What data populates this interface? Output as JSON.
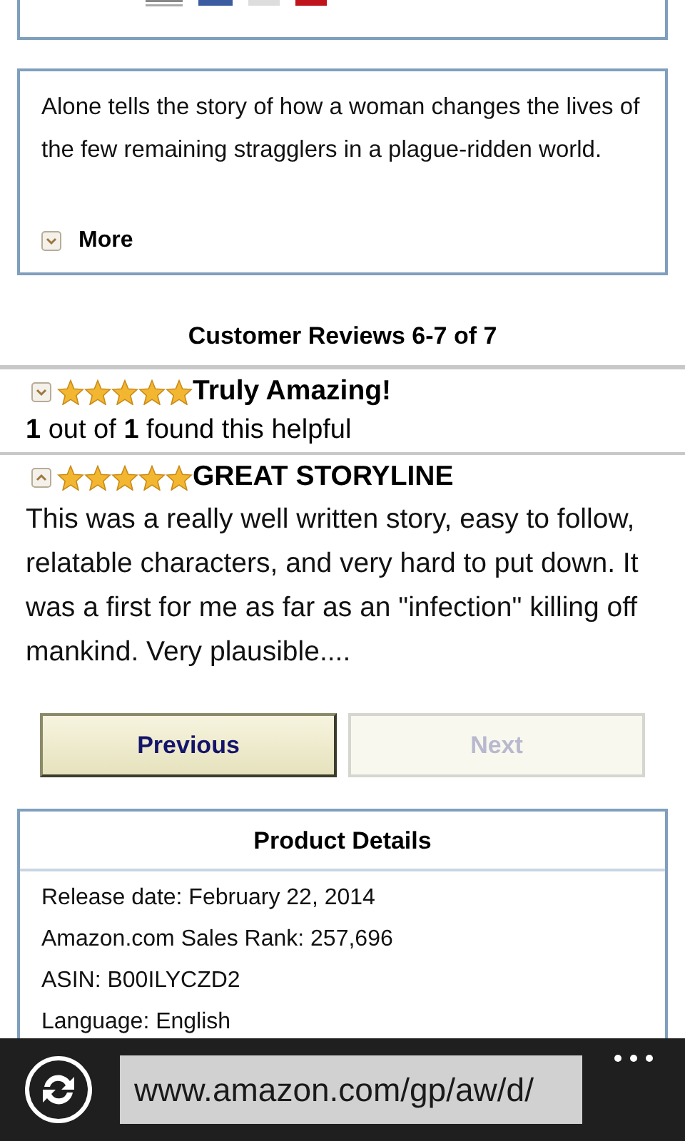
{
  "description": {
    "text": "Alone tells the story of how a woman changes the lives of the few remaining stragglers in a plague-ridden world.",
    "more": {
      "label": "More",
      "expanded": false
    }
  },
  "reviews_heading": "Customer Reviews 6-7 of 7",
  "reviews": [
    {
      "title": "Truly Amazing!",
      "stars": 5,
      "expanded": false,
      "helpful": "**1** out of **1** found this helpful"
    },
    {
      "title": "GREAT STORYLINE",
      "stars": 5,
      "expanded": true,
      "body": "This was a really well written story, easy to follow, relatable characters, and very hard to put down. It was a first for me as far as an \"infection\" killing off mankind. Very plausible...."
    }
  ],
  "pagination": [
    {
      "label": "Previous",
      "disabled": false
    },
    {
      "label": "Next",
      "disabled": true
    }
  ],
  "product_details": {
    "title": "Product Details",
    "rows": [
      "Release date: February 22, 2014",
      "Amazon.com Sales Rank: 257,696",
      "ASIN: B00ILYCZD2",
      "Language: English"
    ]
  },
  "address_bar": {
    "url": "www.amazon.com/gp/aw/d/"
  }
}
